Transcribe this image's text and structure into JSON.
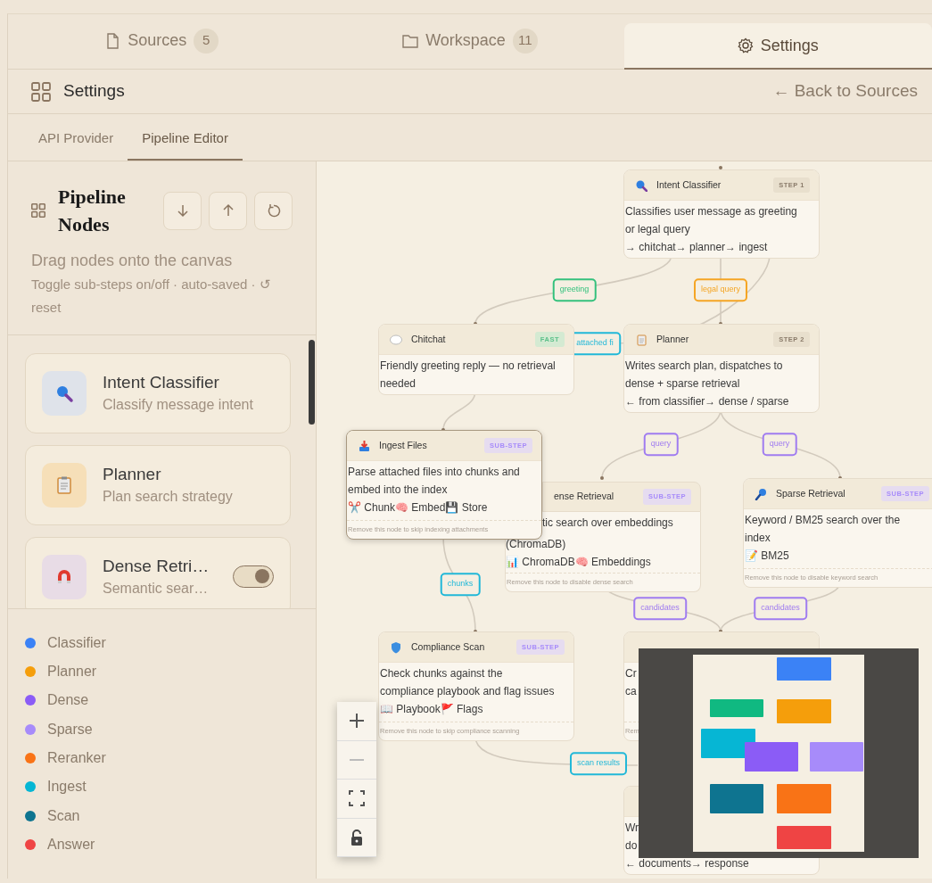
{
  "top_tabs": [
    {
      "label": "Sources",
      "count": "5",
      "selected": false
    },
    {
      "label": "Workspace",
      "count": "11",
      "selected": false
    },
    {
      "label": "Settings",
      "selected": true
    }
  ],
  "header": {
    "title": "Settings",
    "back_link": "← Back to Sources"
  },
  "sub_tabs": [
    {
      "label": "API Provider",
      "selected": false
    },
    {
      "label": "Pipeline Editor",
      "selected": true
    }
  ],
  "palette": {
    "title": "Pipeline Nodes",
    "subtitle": "Drag nodes onto the canvas",
    "hint": "Toggle sub-steps on/off · auto-saved · ↺ reset",
    "cards": [
      {
        "title": "Intent Classifier",
        "description": "Classify message intent",
        "kind": "core"
      },
      {
        "title": "Planner",
        "description": "Plan search strategy",
        "kind": "core"
      },
      {
        "title": "Dense Retri…",
        "description": "Semantic sear…",
        "kind": "optional",
        "on": true
      }
    ]
  },
  "legend": [
    {
      "label": "Classifier",
      "color": "#3b82f6"
    },
    {
      "label": "Planner",
      "color": "#f59e0b"
    },
    {
      "label": "Dense",
      "color": "#8b5cf6"
    },
    {
      "label": "Sparse",
      "color": "#a78bfa"
    },
    {
      "label": "Reranker",
      "color": "#f97316"
    },
    {
      "label": "Ingest",
      "color": "#06b6d4"
    },
    {
      "label": "Scan",
      "color": "#0e7490"
    },
    {
      "label": "Answer",
      "color": "#ef4444"
    }
  ],
  "canvas": {
    "nodes": [
      {
        "title": "Intent Classifier",
        "badge": {
          "text": "STEP 1",
          "kind": "step"
        },
        "lines": [
          "Classifies user message as greeting",
          "or legal query",
          "→ chitchat→ planner→ ingest"
        ],
        "selected": false
      },
      {
        "title": "Chitchat",
        "badge": {
          "text": "FAST",
          "kind": "fast"
        },
        "lines": [
          "Friendly greeting reply — no retrieval",
          "needed"
        ],
        "selected": false
      },
      {
        "title": "Planner",
        "badge": {
          "text": "STEP 2",
          "kind": "step"
        },
        "lines": [
          "Writes search plan, dispatches to",
          "dense + sparse retrieval",
          "← from classifier→ dense / sparse"
        ],
        "selected": false
      },
      {
        "title": "ense Retrieval",
        "badge": {
          "text": "SUB-STEP",
          "kind": "substep"
        },
        "lines": [
          "tic search over embeddings",
          "(ChromaDB)",
          "📊 ChromaDB🧠 Embeddings"
        ],
        "footer": "Remove this node to disable dense search",
        "selected": false
      },
      {
        "title": "Ingest Files",
        "badge": {
          "text": "SUB-STEP",
          "kind": "substep"
        },
        "lines": [
          "Parse attached files into chunks and",
          "embed into the index",
          "✂️ Chunk🧠 Embed💾 Store"
        ],
        "footer": "Remove this node to skip indexing attachments",
        "selected": true
      },
      {
        "title": "Sparse Retrieval",
        "badge": {
          "text": "SUB-STEP",
          "kind": "substep"
        },
        "lines": [
          "Keyword / BM25 search over the",
          "index",
          "📝 BM25"
        ],
        "footer": "Remove this node to disable keyword search",
        "selected": false
      },
      {
        "title": "Compliance Scan",
        "badge": {
          "text": "SUB-STEP",
          "kind": "substep"
        },
        "lines": [
          "Check chunks against the",
          "compliance playbook and flag issues",
          "📖 Playbook🚩 Flags"
        ],
        "footer": "Remove this node to skip compliance scanning",
        "selected": false
      },
      {
        "lines": [
          "Cr",
          "ca"
        ],
        "footer": "Rem",
        "selected": false
      },
      {
        "lines": [
          "Wr",
          "do",
          "← documents→ response"
        ],
        "selected": false
      }
    ],
    "edge_labels": [
      {
        "text": "greeting",
        "color": "#34c17d"
      },
      {
        "text": "legal query",
        "color": "#f5a524"
      },
      {
        "text": "attached fi",
        "color": "#22b8d8"
      },
      {
        "text": "query",
        "color": "#a07cf0"
      },
      {
        "text": "query",
        "color": "#a07cf0"
      },
      {
        "text": "chunks",
        "color": "#22b8d8"
      },
      {
        "text": "candidates",
        "color": "#a07cf0"
      },
      {
        "text": "candidates",
        "color": "#a07cf0"
      },
      {
        "text": "scan results",
        "color": "#22b8d8"
      }
    ]
  }
}
